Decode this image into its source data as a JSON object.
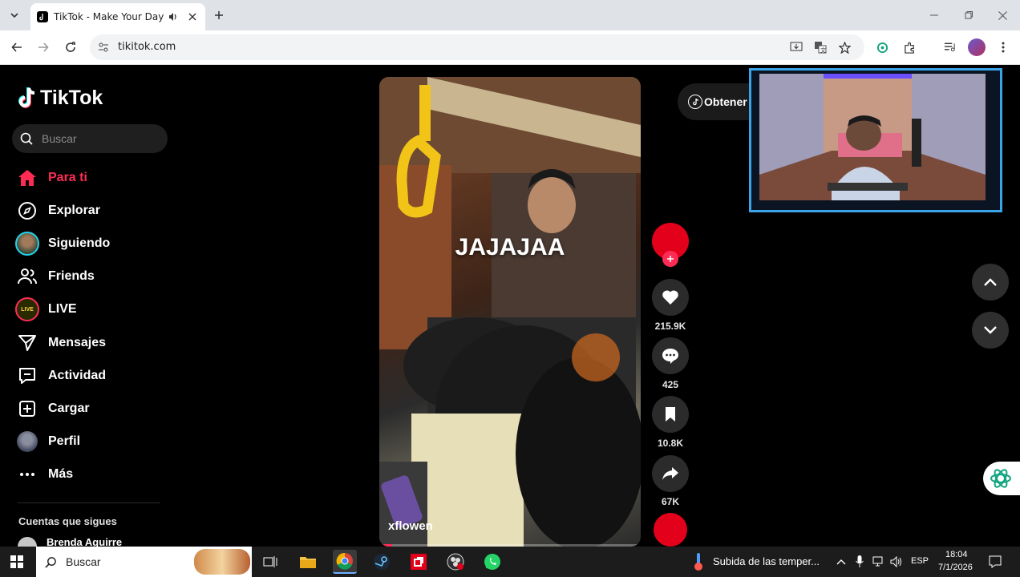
{
  "browser": {
    "tab_title": "TikTok - Make Your Day",
    "url": "tikitok.com"
  },
  "sidebar": {
    "logo_text": "TikTok",
    "search_placeholder": "Buscar",
    "nav": [
      {
        "label": "Para ti",
        "icon": "home-icon",
        "active": true
      },
      {
        "label": "Explorar",
        "icon": "compass-icon"
      },
      {
        "label": "Siguiendo",
        "icon": "following-avatar-icon"
      },
      {
        "label": "Friends",
        "icon": "friends-icon"
      },
      {
        "label": "LIVE",
        "icon": "live-icon"
      },
      {
        "label": "Mensajes",
        "icon": "send-icon"
      },
      {
        "label": "Actividad",
        "icon": "activity-icon"
      },
      {
        "label": "Cargar",
        "icon": "upload-icon"
      },
      {
        "label": "Perfil",
        "icon": "profile-avatar-icon"
      },
      {
        "label": "Más",
        "icon": "more-icon"
      }
    ],
    "following_header": "Cuentas que sigues",
    "following_user": "Brenda Aguirre"
  },
  "video": {
    "caption": "JAJAJAA",
    "author": "xflowen",
    "progress": 0.05
  },
  "actions": {
    "likes": "215.9K",
    "comments": "425",
    "saves": "10.8K",
    "shares": "67K"
  },
  "get_app_label": "Obtener",
  "taskbar": {
    "search_label": "Buscar",
    "weather_text": "Subida de las temper...",
    "language": "ESP",
    "time": "18:04",
    "date": "7/1/2026"
  },
  "colors": {
    "brand": "#fe2c55",
    "record_red": "#e3001b"
  }
}
